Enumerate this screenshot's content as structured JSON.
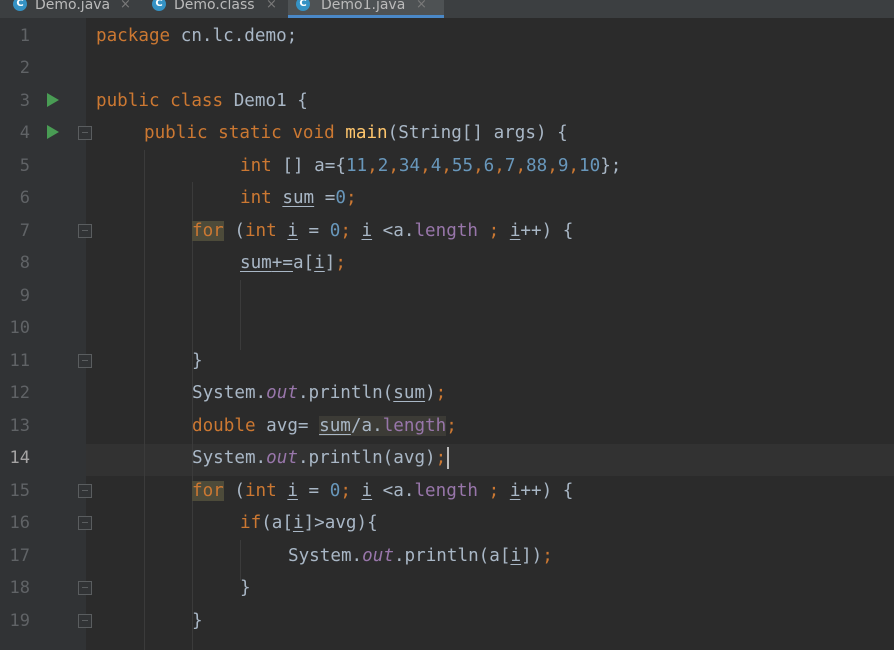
{
  "tabs": [
    {
      "icon": "C",
      "name": "Demo.java",
      "close": "×",
      "active": false
    },
    {
      "icon": "C",
      "name": "Demo.class",
      "close": "×",
      "active": false
    },
    {
      "icon": "C",
      "name": "Demo1.java",
      "close": "×",
      "active": true
    }
  ],
  "current_line": "14",
  "gutter": {
    "line_numbers": [
      "1",
      "2",
      "3",
      "4",
      "5",
      "6",
      "7",
      "8",
      "9",
      "10",
      "11",
      "12",
      "13",
      "14",
      "15",
      "16",
      "17",
      "18",
      "19"
    ]
  },
  "code": {
    "l1": {
      "kw": "package",
      "rest": " cn.lc.demo;"
    },
    "l3": {
      "kw1": "public",
      "kw2": "class",
      "name": " Demo1 {"
    },
    "l4": {
      "kw1": "public",
      "kw2": "static",
      "kw3": "void",
      "fn": "main",
      "rest": "(String[] args) {"
    },
    "l5": {
      "kw": "int",
      "a": " [] a={",
      "nums": [
        "11",
        "2",
        "34",
        "4",
        "55",
        "6",
        "7",
        "88",
        "9",
        "10"
      ],
      "end": "};"
    },
    "l6": {
      "kw": "int",
      "var": "sum",
      "eq": " =",
      "num": "0",
      "semi": ";"
    },
    "l7": {
      "kw_for": "for",
      "p": " (",
      "kw_int": "int",
      "i1": "i",
      "eq": " = ",
      "zero": "0",
      "semi": ";",
      "i2": "i",
      "lt": " <a.",
      "len": "length",
      "semi2": " ;",
      "i3": "i",
      "rest": "++) {"
    },
    "l8": {
      "var": "sum",
      "op": "+=",
      "a": "a[",
      "i": "i",
      "close": "]",
      "semi": ";"
    },
    "l11": {
      "brace": "}"
    },
    "l12": {
      "cls": "System.",
      "out": "out",
      "call": ".println(",
      "arg": "sum",
      "close": ")",
      "semi": ";"
    },
    "l13": {
      "kw": "double",
      "a": " avg= ",
      "sum": "sum",
      "b": "/a.",
      "len": "length",
      "semi": ";"
    },
    "l14": {
      "cls": "System.",
      "out": "out",
      "call": ".println(avg)",
      "semi": ";"
    },
    "l15": {
      "kw_for": "for",
      "p": " (",
      "kw_int": "int",
      "i1": "i",
      "eq": " = ",
      "zero": "0",
      "semi": ";",
      "i2": "i",
      "lt": " <a.",
      "len": "length",
      "semi2": " ;",
      "i3": "i",
      "rest": "++) {"
    },
    "l16": {
      "kw": "if",
      "a": "(a[",
      "i": "i",
      "b": "]>avg){"
    },
    "l17": {
      "cls": "System.",
      "out": "out",
      "call": ".println(a[",
      "i": "i",
      "close": "])",
      "semi": ";"
    },
    "l18": {
      "brace": "}"
    },
    "l19": {
      "brace": "}"
    }
  }
}
